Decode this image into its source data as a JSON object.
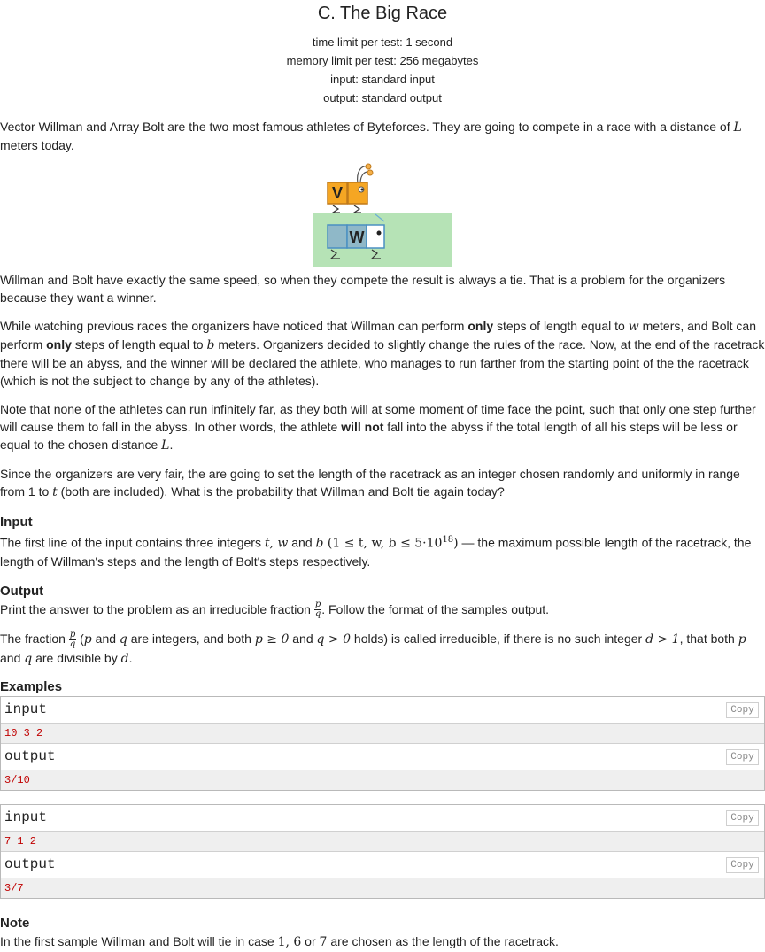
{
  "problem": {
    "title": "C. The Big Race",
    "time_limit": "time limit per test: 1 second",
    "memory_limit": "memory limit per test: 256 megabytes",
    "input": "input: standard input",
    "output": "output: standard output"
  },
  "statement": {
    "p1a": "Vector Willman and Array Bolt are the two most famous athletes of Byteforces. They are going to compete in a race with a distance of ",
    "p1var": "L",
    "p1b": " meters today.",
    "illustration": {
      "letter_v": "V",
      "letter_w": "W"
    },
    "p2": "Willman and Bolt have exactly the same speed, so when they compete the result is always a tie. That is a problem for the organizers because they want a winner.",
    "p3a": "While watching previous races the organizers have noticed that Willman can perform ",
    "p3b": "only",
    "p3c": " steps of length equal to ",
    "p3w": "w",
    "p3d": " meters, and Bolt can perform ",
    "p3e": "only",
    "p3f": " steps of length equal to ",
    "p3bvar": "b",
    "p3g": " meters. Organizers decided to slightly change the rules of the race. Now, at the end of the racetrack there will be an abyss, and the winner will be declared the athlete, who manages to run farther from the starting point of the the racetrack (which is not the subject to change by any of the athletes).",
    "p4a": "Note that none of the athletes can run infinitely far, as they both will at some moment of time face the point, such that only one step further will cause them to fall in the abyss. In other words, the athlete ",
    "p4b": "will not",
    "p4c": " fall into the abyss if the total length of all his steps will be less or equal to the chosen distance ",
    "p4var": "L",
    "p4d": ".",
    "p5a": "Since the organizers are very fair, the are going to set the length of the racetrack as an integer chosen randomly and uniformly in range from 1 to ",
    "p5var": "t",
    "p5b": " (both are included). What is the probability that Willman and Bolt tie again today?"
  },
  "input_spec": {
    "title": "Input",
    "a": "The first line of the input contains three integers ",
    "vars": "t, w",
    "and": " and ",
    "b": "b",
    "constraint": " (1 ≤ t, w, b ≤ 5·10",
    "exp": "18",
    "close": ")",
    "rest": " — the maximum possible length of the racetrack, the length of Willman's steps and the length of Bolt's steps respectively."
  },
  "output_spec": {
    "title": "Output",
    "a": "Print the answer to the problem as an irreducible fraction ",
    "frac_num": "p",
    "frac_den": "q",
    "b": ". Follow the format of the samples output.",
    "c1": "The fraction ",
    "c2": " (",
    "p": "p",
    "and1": " and ",
    "q": "q",
    "c3": " are integers, and both ",
    "cond1": "p ≥ 0",
    "and2": " and ",
    "cond2": "q > 0",
    "c4": " holds) is called irreducible, if there is no such integer ",
    "cond3": "d > 1",
    "c5": ", that both ",
    "p2": "p",
    "and3": " and",
    "q2": "q",
    "c6": " are divisible by ",
    "d": "d",
    "c7": "."
  },
  "examples": {
    "title": "Examples",
    "copy_label": "Copy",
    "input_label": "input",
    "output_label": "output",
    "items": [
      {
        "input": "10 3 2",
        "output": "3/10"
      },
      {
        "input": "7 1 2",
        "output": "3/7"
      }
    ]
  },
  "note": {
    "title": "Note",
    "a": "In the first sample Willman and Bolt will tie in case ",
    "vals": "1, 6",
    "or": " or ",
    "last": "7",
    "b": " are chosen as the length of the racetrack."
  }
}
